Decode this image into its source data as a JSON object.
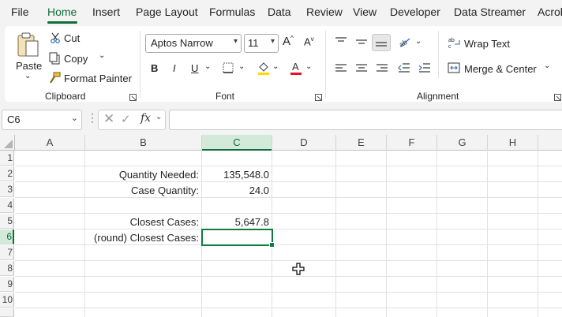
{
  "menu": {
    "tabs": [
      "File",
      "Home",
      "Insert",
      "Page Layout",
      "Formulas",
      "Data",
      "Review",
      "View",
      "Developer",
      "Data Streamer",
      "Acrob"
    ],
    "active": "Home"
  },
  "clipboard": {
    "paste": "Paste",
    "cut": "Cut",
    "copy": "Copy",
    "format_painter": "Format Painter",
    "group_label": "Clipboard"
  },
  "font": {
    "font_name": "Aptos Narrow",
    "font_size": "11",
    "bold": "B",
    "italic": "I",
    "underline": "U",
    "group_label": "Font",
    "accent_fill": "#ffd700",
    "accent_font": "#e81123"
  },
  "alignment": {
    "wrap_text": "Wrap Text",
    "merge_center": "Merge & Center",
    "group_label": "Alignment"
  },
  "formula_bar": {
    "name_box": "C6",
    "fx": "fx",
    "formula": ""
  },
  "grid": {
    "columns": [
      "A",
      "B",
      "C",
      "D",
      "E",
      "F",
      "G",
      "H"
    ],
    "rows": [
      "1",
      "2",
      "3",
      "4",
      "5",
      "6",
      "7",
      "8",
      "9",
      "10"
    ],
    "selected_column": "C",
    "selected_row": "6",
    "cells": {
      "B2": "Quantity Needed:",
      "C2": "135,548.0",
      "B3": "Case Quantity:",
      "C3": "24.0",
      "B5": "Closest Cases:",
      "C5": "5,647.8",
      "B6": "(round) Closest Cases:",
      "C6": ""
    }
  },
  "colors": {
    "accent": "#107c41",
    "header_selected": "#d3e9d9"
  }
}
